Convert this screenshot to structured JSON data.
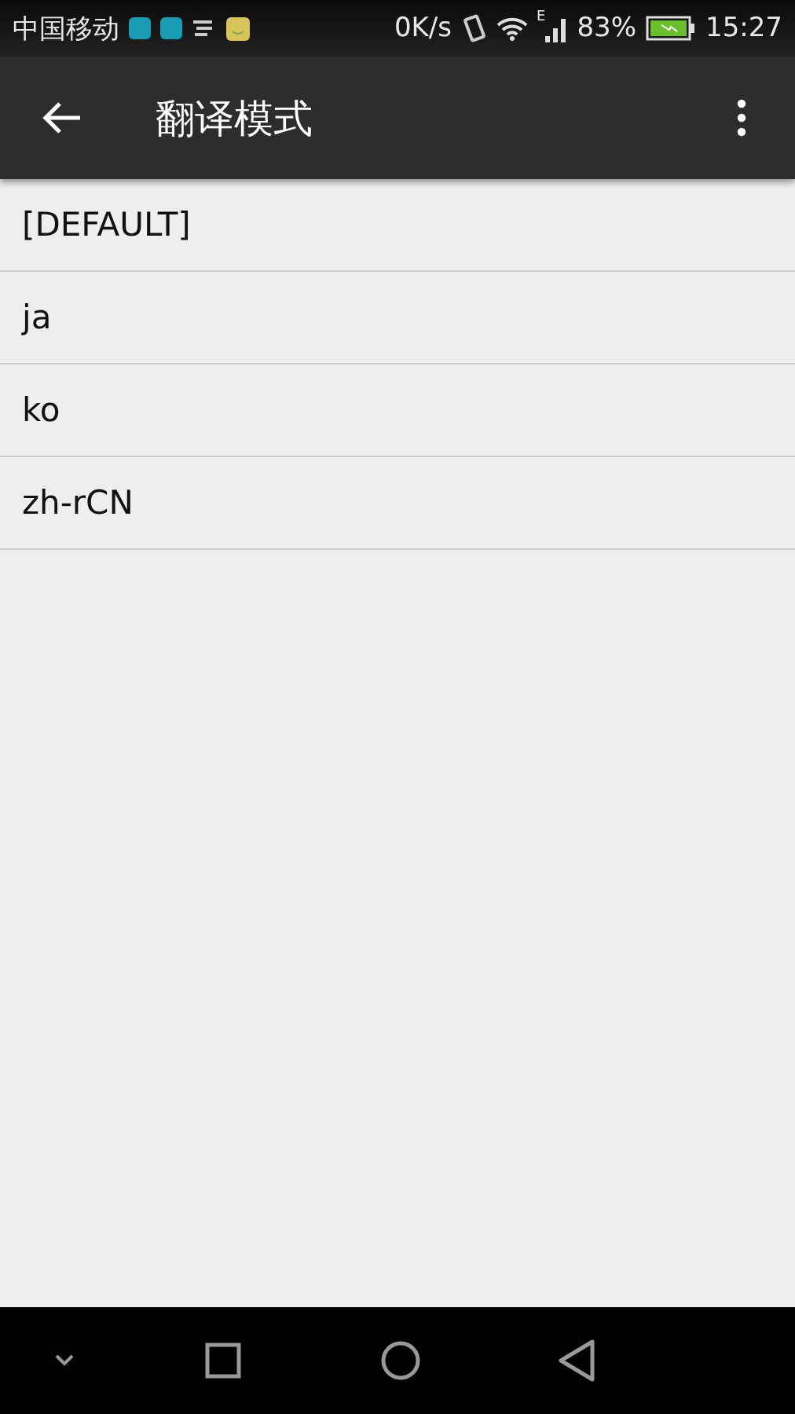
{
  "status_bar": {
    "carrier": "中国移动",
    "speed": "0K/s",
    "network": "E",
    "battery": "83%",
    "time": "15:27"
  },
  "app_bar": {
    "title": "翻译模式"
  },
  "items": [
    {
      "label": "[DEFAULT]"
    },
    {
      "label": "ja"
    },
    {
      "label": "ko"
    },
    {
      "label": "zh-rCN"
    }
  ]
}
